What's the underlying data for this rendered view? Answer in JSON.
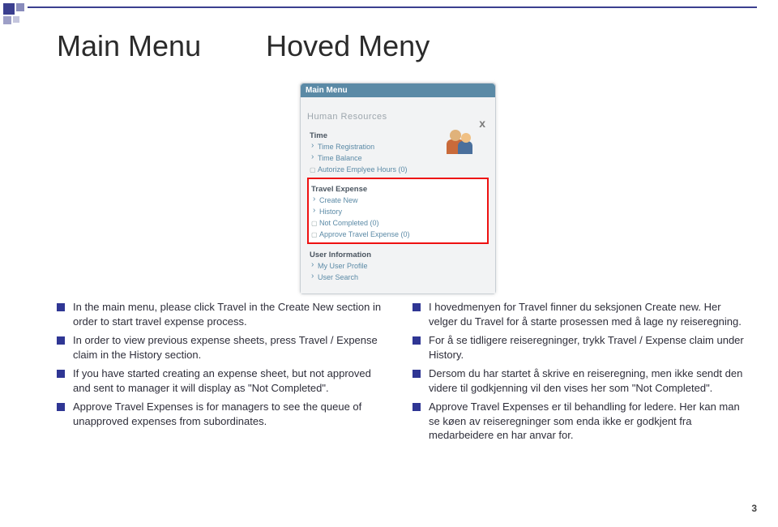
{
  "heading_left": "Main Menu",
  "heading_right": "Hoved Meny",
  "panel": {
    "title": "Main Menu",
    "hr_header": "Human Resources",
    "groups": [
      {
        "title": "Time",
        "highlight": false,
        "items": [
          {
            "label": "Time Registration",
            "check": false
          },
          {
            "label": "Time Balance",
            "check": false
          },
          {
            "label": "Autorize Emplyee Hours (0)",
            "check": true
          }
        ]
      },
      {
        "title": "Travel Expense",
        "highlight": true,
        "items": [
          {
            "label": "Create New",
            "check": false
          },
          {
            "label": "History",
            "check": false
          },
          {
            "label": "Not Completed (0)",
            "check": true
          },
          {
            "label": "Approve Travel Expense (0)",
            "check": true
          }
        ]
      },
      {
        "title": "User Information",
        "highlight": false,
        "items": [
          {
            "label": "My User Profile",
            "check": false
          },
          {
            "label": "User Search",
            "check": false
          }
        ]
      }
    ]
  },
  "left_bullets": [
    "In the main menu, please click Travel  in the Create New section in order to start travel expense process.",
    "In order to view previous expense sheets, press Travel / Expense claim in the History section.",
    "If you have started creating an expense sheet, but not approved and sent to manager it will display as \"Not Completed\".",
    "Approve Travel Expenses is for managers to see the queue of unapproved expenses from subordinates."
  ],
  "right_bullets": [
    "I hovedmenyen for Travel finner du seksjonen Create new. Her velger du Travel for å starte prosessen med å lage ny reiseregning.",
    "For å se tidligere reiseregninger, trykk Travel / Expense claim under History.",
    "Dersom du har startet å skrive en reiseregning, men ikke sendt den videre til godkjenning vil den vises her som \"Not Completed\".",
    "Approve Travel Expenses er til behandling for ledere. Her kan man se køen av reiseregninger som enda ikke er godkjent fra medarbeidere en har anvar for."
  ],
  "page_number": "3"
}
